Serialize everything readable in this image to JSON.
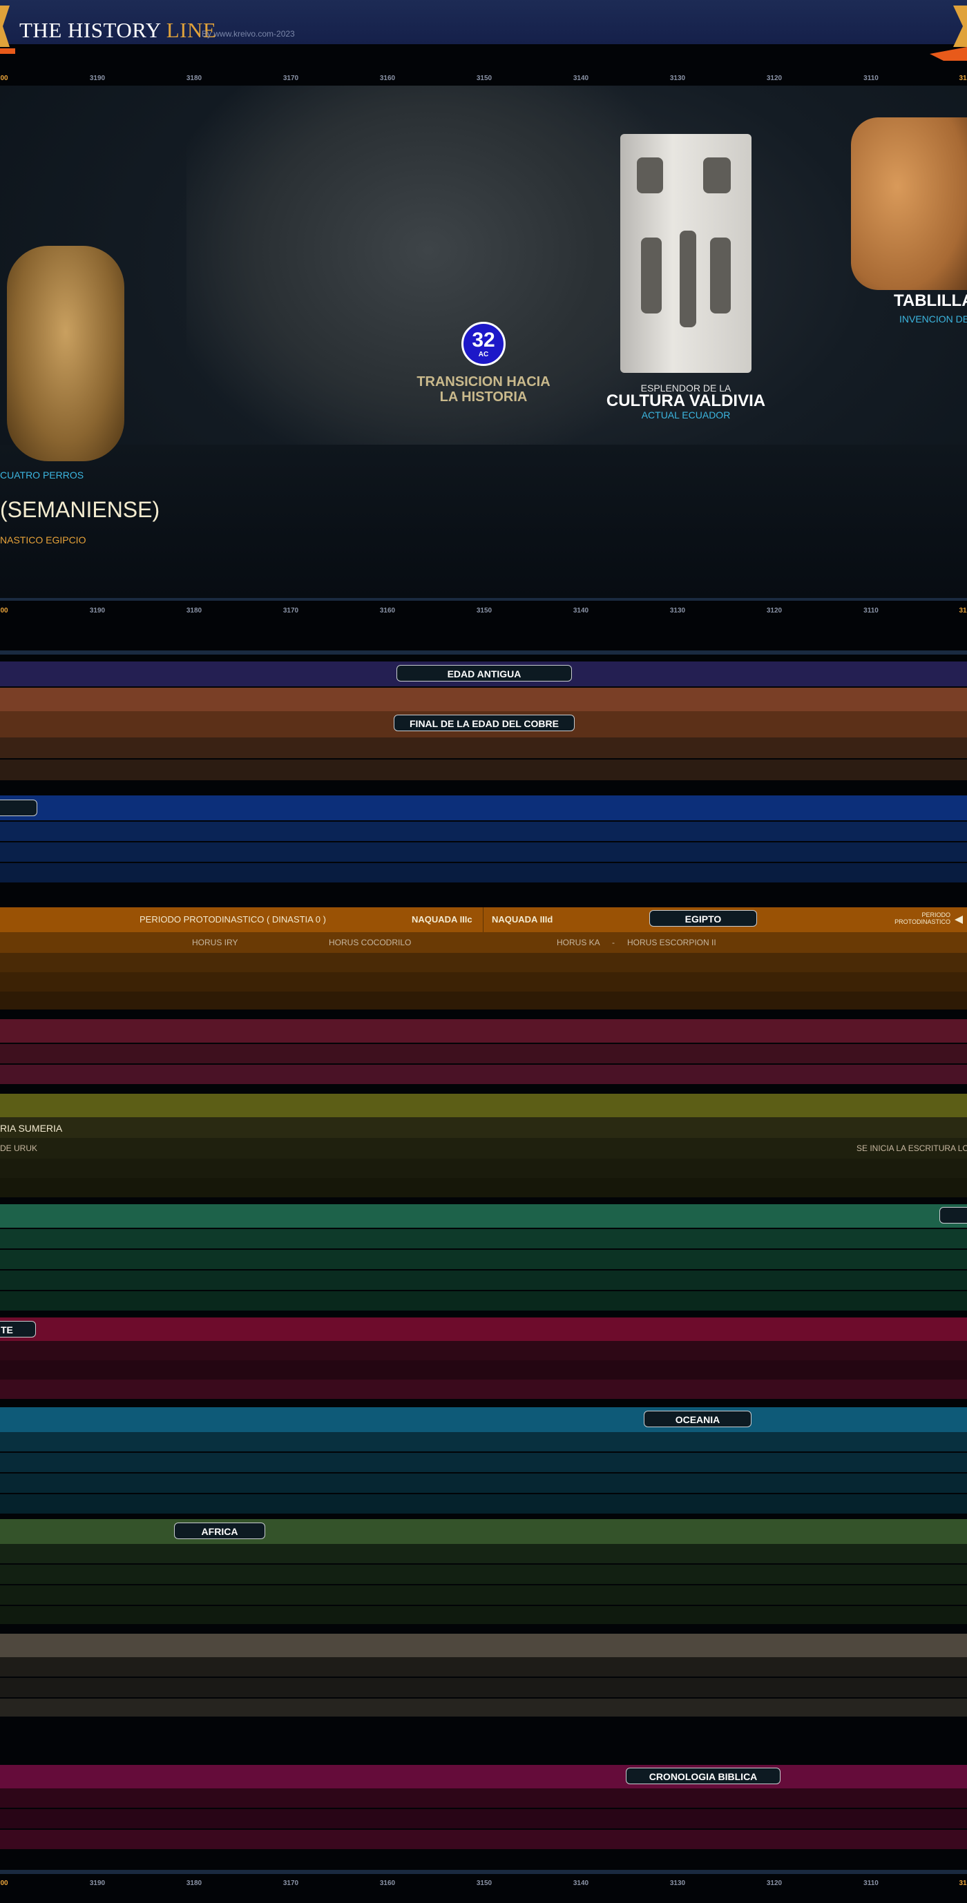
{
  "header": {
    "logo_main": "THE HISTORY",
    "logo_accent": "LINE",
    "byline": "By www.kreivo.com-2023"
  },
  "ruler": {
    "edge_left": "00",
    "edge_right": "31",
    "ticks": [
      "3190",
      "3180",
      "3170",
      "3160",
      "3150",
      "3140",
      "3130",
      "3120",
      "3110"
    ]
  },
  "stage": {
    "badge_number": "32",
    "badge_era": "AC",
    "transition_line1": "TRANSICION HACIA",
    "transition_line2": "LA HISTORIA",
    "valdivia_pre": "ESPLENDOR DE LA",
    "valdivia_title": "CULTURA VALDIVIA",
    "valdivia_sub": "ACTUAL ECUADOR",
    "tablet_title": "TABLILLA",
    "tablet_sub": "INVENCION DE",
    "palette_label": "CUATRO PERROS",
    "culture_title": "(SEMANIENSE)",
    "culture_sub": "NASTICO EGIPCIO"
  },
  "timeline": {
    "edad_antigua": "EDAD ANTIGUA",
    "edad_cobre": "FINAL DE LA EDAD DEL COBRE",
    "egipto": {
      "periodo": "PERIODO PROTODINASTICO ( DINASTIA 0 )",
      "naquada_c": "NAQUADA IIIc",
      "naquada_d": "NAQUADA IIId",
      "label": "EGIPTO",
      "proto_line1": "PERIODO",
      "proto_line2": "PROTODINASTICO",
      "horus_iry": "HORUS IRY",
      "horus_cocodrilo": "HORUS COCODRILO",
      "horus_ka": "HORUS KA",
      "dash": "-",
      "horus_escorpion": "HORUS ESCORPION II"
    },
    "sumeria": {
      "title": "RIA SUMERIA",
      "uruk": "DE URUK",
      "escritura": "SE INICIA LA ESCRITURA LO Q"
    },
    "te_label": "TE",
    "oceania": "OCEANIA",
    "africa": "AFRICA",
    "biblica": "CRONOLOGIA BIBLICA"
  },
  "colors": {
    "header": "#1d2b55",
    "edad_antigua": "#241f52",
    "cobre": "#7a3f26",
    "asia_blue": "#0c2f7a",
    "egipto": "#9a5205",
    "maroon": "#5a1528",
    "olive": "#5c5e16",
    "teal": "#1d624a",
    "crimson": "#6e0c2c",
    "cyan": "#0e5a78",
    "green": "#34532a",
    "taupe": "#4f483e",
    "magenta": "#650c3a",
    "accent": "#e8a33a"
  }
}
